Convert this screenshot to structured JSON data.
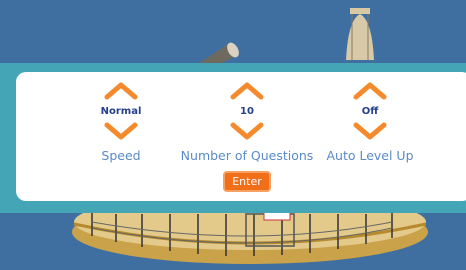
{
  "settings": [
    {
      "value": "Normal",
      "label": "Speed",
      "up_icon": "chevron-up-icon",
      "down_icon": "chevron-down-icon"
    },
    {
      "value": "10",
      "label": "Number of Questions",
      "up_icon": "chevron-up-icon",
      "down_icon": "chevron-down-icon"
    },
    {
      "value": "Off",
      "label": "Auto Level Up",
      "up_icon": "chevron-up-icon",
      "down_icon": "chevron-down-icon"
    }
  ],
  "enter_label": "Enter",
  "colors": {
    "background": "#3f6fa0",
    "panel_band": "#44a5b6",
    "panel": "#ffffff",
    "arrow": "#f58a2c",
    "value_text": "#26408a",
    "label_text": "#5a8ac8",
    "enter_button": "#f26f1a"
  }
}
